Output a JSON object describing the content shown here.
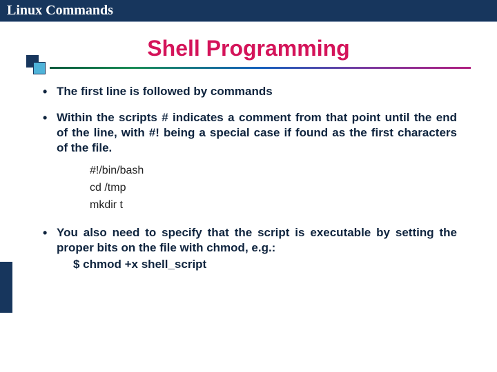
{
  "header": {
    "title": "Linux Commands"
  },
  "slide": {
    "title": "Shell Programming",
    "bullets": [
      "The first line is followed by commands",
      "Within the scripts # indicates a comment from that point until the end of the line, with #! being a special case if found as the first characters of the file.",
      "You also need to specify that the script is executable by setting the proper bits on the file with chmod, e.g.:"
    ],
    "code": {
      "line1": "#!/bin/bash",
      "line2": "cd /tmp",
      "line3": "mkdir t"
    },
    "chmod_example": "$ chmod +x shell_script"
  }
}
